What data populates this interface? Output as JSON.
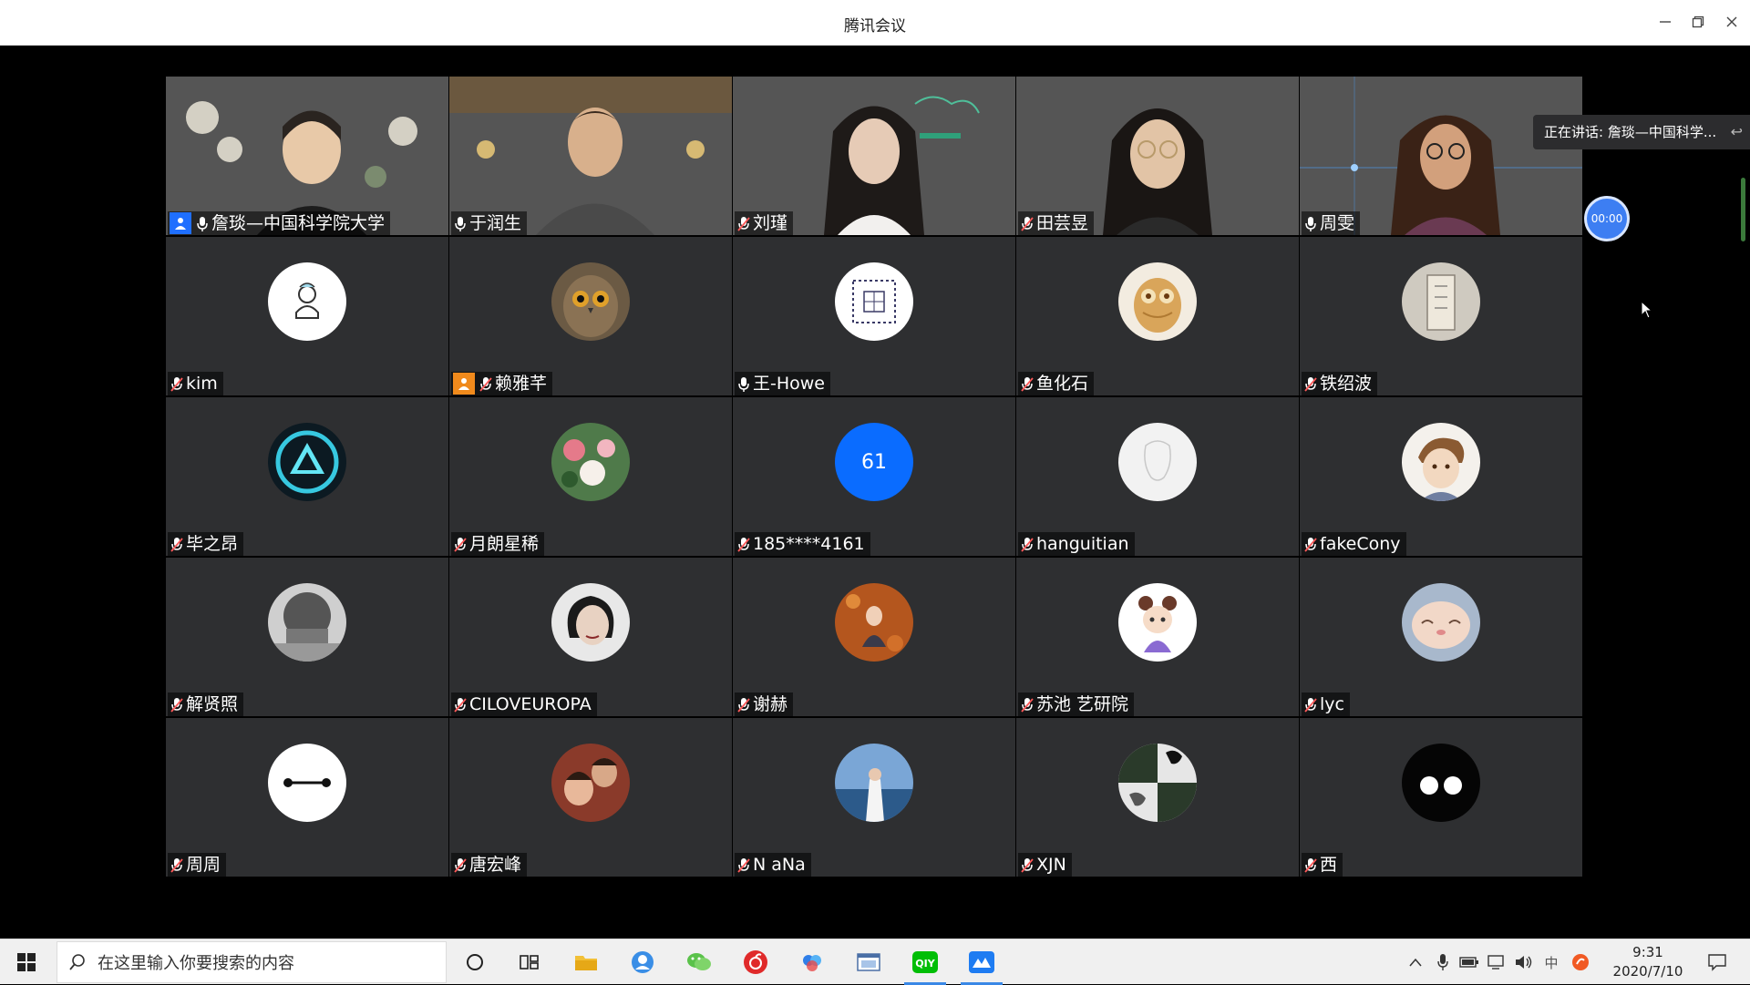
{
  "window": {
    "title": "腾讯会议"
  },
  "speaking": {
    "text": "正在讲话: 詹琰—中国科学..."
  },
  "timer": {
    "value": "00:00"
  },
  "participants": [
    {
      "name": "詹琰—中国科学院大学",
      "badge": "host"
    },
    {
      "name": "于润生"
    },
    {
      "name": "刘瑾"
    },
    {
      "name": "田芸昱"
    },
    {
      "name": "周雯"
    },
    {
      "name": "kim"
    },
    {
      "name": "赖雅芊",
      "badge": "cohost"
    },
    {
      "name": "王-Howe"
    },
    {
      "name": "鱼化石"
    },
    {
      "name": "铁绍波"
    },
    {
      "name": "毕之昂"
    },
    {
      "name": "月朗星稀"
    },
    {
      "name": "185****4161",
      "avatar_text": "61"
    },
    {
      "name": "hanguitian"
    },
    {
      "name": "fakeCony"
    },
    {
      "name": "解贤照"
    },
    {
      "name": "CILOVEUROPA"
    },
    {
      "name": "谢赫"
    },
    {
      "name": "苏池 艺研院"
    },
    {
      "name": "lyc"
    },
    {
      "name": "周周"
    },
    {
      "name": "唐宏峰"
    },
    {
      "name": "N aNa"
    },
    {
      "name": "XJN"
    },
    {
      "name": "西"
    }
  ],
  "taskbar": {
    "search_placeholder": "在这里输入你要搜索的内容",
    "time": "9:31",
    "date": "2020/7/10",
    "ime": "中"
  }
}
